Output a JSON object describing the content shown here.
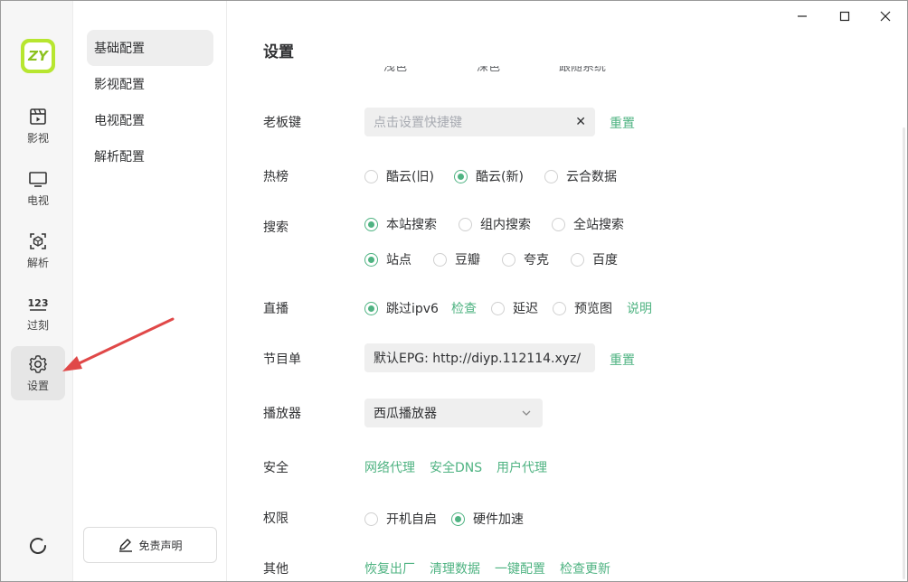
{
  "rail": {
    "logo_text": "ZY",
    "items": [
      {
        "label": "影视",
        "icon": "film-icon"
      },
      {
        "label": "电视",
        "icon": "tv-icon"
      },
      {
        "label": "解析",
        "icon": "parse-icon"
      },
      {
        "label": "过刻",
        "icon": "number-123-icon"
      },
      {
        "label": "设置",
        "icon": "gear-icon",
        "active": true
      }
    ]
  },
  "submenu": {
    "items": [
      {
        "label": "基础配置",
        "active": true
      },
      {
        "label": "影视配置"
      },
      {
        "label": "电视配置"
      },
      {
        "label": "解析配置"
      }
    ],
    "disclaimer": "免责声明"
  },
  "main": {
    "title": "设置",
    "theme_options_cut": [
      "浅色",
      "深色",
      "跟随系统"
    ],
    "boss_key": {
      "label": "老板键",
      "placeholder": "点击设置快捷键",
      "reset": "重置"
    },
    "hot": {
      "label": "热榜",
      "options": [
        "酷云(旧)",
        "酷云(新)",
        "云合数据"
      ],
      "selected": 1
    },
    "search": {
      "label": "搜索",
      "scope_options": [
        "本站搜索",
        "组内搜索",
        "全站搜索"
      ],
      "scope_selected": 0,
      "source_options": [
        "站点",
        "豆瓣",
        "夸克",
        "百度"
      ],
      "source_selected": 0
    },
    "live": {
      "label": "直播",
      "skip_ipv6": "跳过ipv6",
      "check": "检查",
      "delay": "延迟",
      "preview": "预览图",
      "explain": "说明"
    },
    "epg": {
      "label": "节目单",
      "value": "默认EPG:  http://diyp.112114.xyz/",
      "reset": "重置"
    },
    "player": {
      "label": "播放器",
      "value": "西瓜播放器"
    },
    "security": {
      "label": "安全",
      "links": [
        "网络代理",
        "安全DNS",
        "用户代理"
      ]
    },
    "permission": {
      "label": "权限",
      "options": [
        "开机自启",
        "硬件加速"
      ],
      "selected": 1
    },
    "other": {
      "label": "其他",
      "links": [
        "恢复出厂",
        "清理数据",
        "一键配置",
        "检查更新"
      ]
    }
  },
  "colors": {
    "accent": "#4fb382",
    "arrow": "#e04848",
    "logo": "#b7e630"
  }
}
